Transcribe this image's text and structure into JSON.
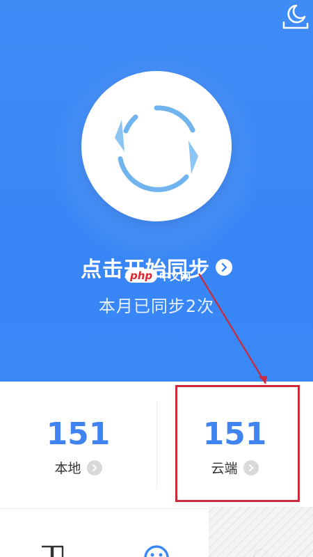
{
  "header": {
    "night_mode_icon": "moon-bed-icon"
  },
  "sync": {
    "sync_icon": "sync-arrows-icon",
    "start_label": "点击开始同步",
    "start_arrow_icon": "chevron-right-circle-icon",
    "count_text": "本月已同步2次"
  },
  "stats": {
    "local": {
      "value": "151",
      "label": "本地",
      "icon": "chevron-right-circle-icon"
    },
    "cloud": {
      "value": "151",
      "label": "云端",
      "icon": "chevron-right-circle-icon"
    }
  },
  "watermark": {
    "badge": "php",
    "text": "中文网"
  },
  "annotation": {
    "color": "#cc2a3a"
  },
  "tabbar": {
    "tabs": [
      {
        "icon": "book-icon"
      },
      {
        "icon": "sync-icon"
      },
      {
        "icon": "profile-icon"
      }
    ]
  },
  "colors": {
    "primary": "#3a88f6",
    "stat_value": "#3f84f0"
  }
}
